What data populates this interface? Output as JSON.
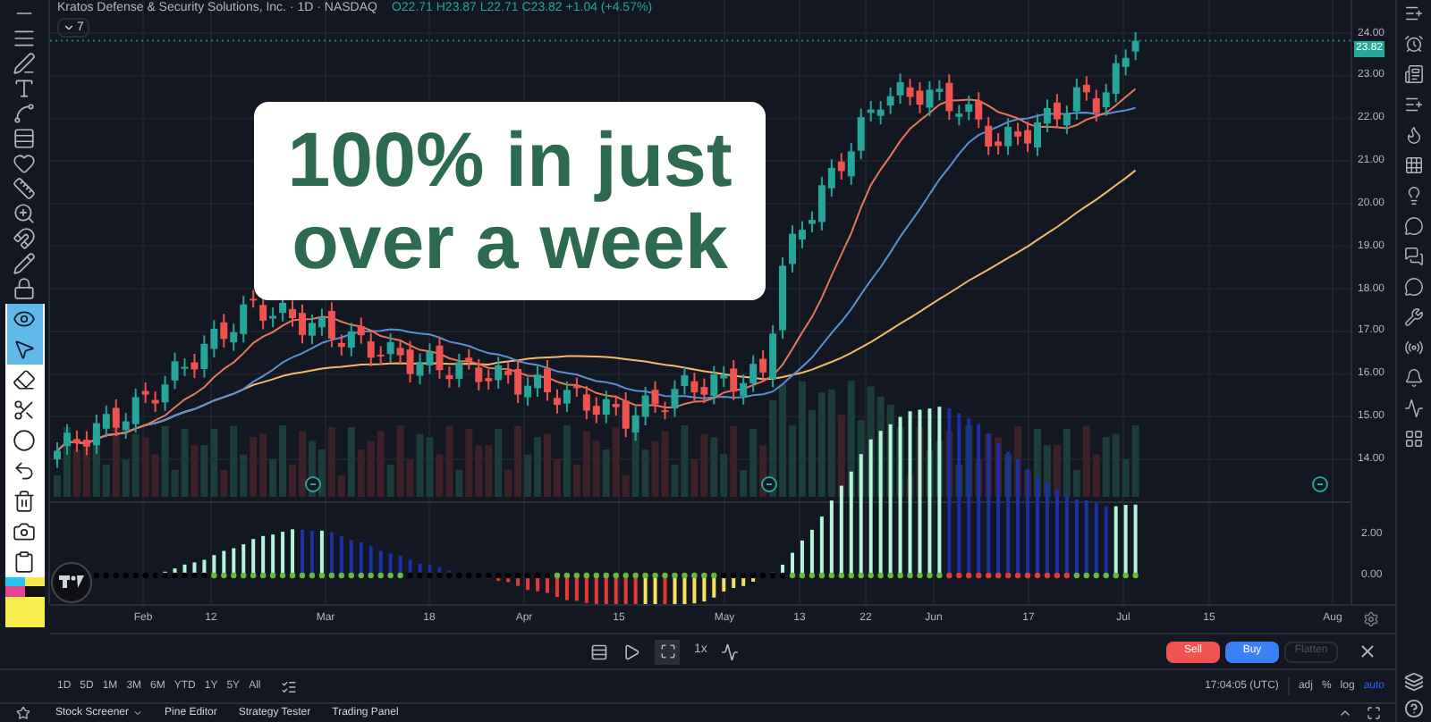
{
  "header": {
    "symbol": "Kratos Defense & Security Solutions, Inc. · 1D · NASDAQ",
    "ohlc": "O22.71 H23.87 L22.71 C23.82 +1.04 (+4.57%)",
    "indicator_count": "7"
  },
  "caption": {
    "lines": [
      "100% in just",
      "over a week"
    ]
  },
  "price_axis": {
    "labels": [
      "24.00",
      "23.00",
      "22.00",
      "21.00",
      "20.00",
      "19.00",
      "18.00",
      "17.00",
      "16.00",
      "15.00",
      "14.00"
    ],
    "current_price": "23.82"
  },
  "indicator_axis": {
    "labels": [
      "2.00",
      "0.00"
    ]
  },
  "time_axis": {
    "labels": [
      "Feb",
      "12",
      "Mar",
      "18",
      "Apr",
      "15",
      "May",
      "13",
      "22",
      "Jun",
      "17",
      "Jul",
      "15",
      "Aug"
    ]
  },
  "replay_bar": {
    "speed": "1x"
  },
  "order_buttons": [
    {
      "kind": "sell",
      "label": "Sell"
    },
    {
      "kind": "buy",
      "label": "Buy"
    },
    {
      "kind": "flatten",
      "label": "Flatten"
    }
  ],
  "ranges": [
    "1D",
    "5D",
    "1M",
    "3M",
    "6M",
    "YTD",
    "1Y",
    "5Y",
    "All"
  ],
  "clock": "17:04:05 (UTC)",
  "scale_options": [
    {
      "label": "adj",
      "selected": false
    },
    {
      "label": "%",
      "selected": false
    },
    {
      "label": "log",
      "selected": false
    },
    {
      "label": "auto",
      "selected": true
    }
  ],
  "bottom_tabs": [
    {
      "label": "Stock Screener",
      "dropdown": true
    },
    {
      "label": "Pine Editor",
      "dropdown": false
    },
    {
      "label": "Strategy Tester",
      "dropdown": false
    },
    {
      "label": "Trading Panel",
      "dropdown": false
    }
  ]
}
